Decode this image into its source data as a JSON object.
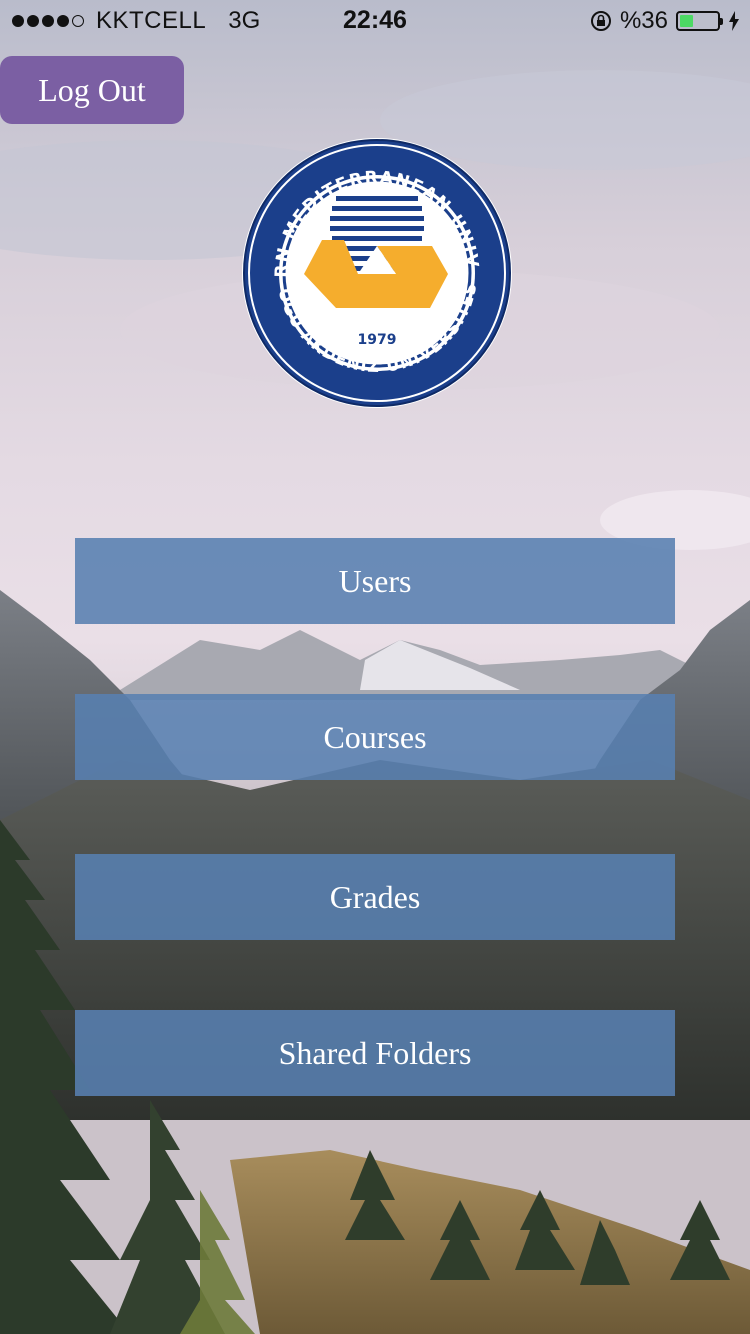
{
  "status_bar": {
    "carrier": "KKTCELL",
    "network": "3G",
    "time": "22:46",
    "battery_text": "%36",
    "battery_level": 0.36,
    "signal_bars_filled": 4,
    "signal_bars_total": 5
  },
  "header": {
    "logout_label": "Log Out"
  },
  "logo": {
    "top_text": "EASTERN MEDITERRANEAN UNIVERSITY",
    "bottom_text": "DOĞU AKDENİZ ÜNİVERSİTESİ",
    "year": "1979"
  },
  "menu": {
    "users_label": "Users",
    "courses_label": "Courses",
    "grades_label": "Grades",
    "shared_folders_label": "Shared Folders"
  },
  "colors": {
    "logout_bg": "#7b5fa3",
    "menu_button_bg": "#5880b0",
    "logo_navy": "#1b3f8b",
    "logo_gold": "#f5ad2d",
    "battery_green": "#4cd964"
  }
}
